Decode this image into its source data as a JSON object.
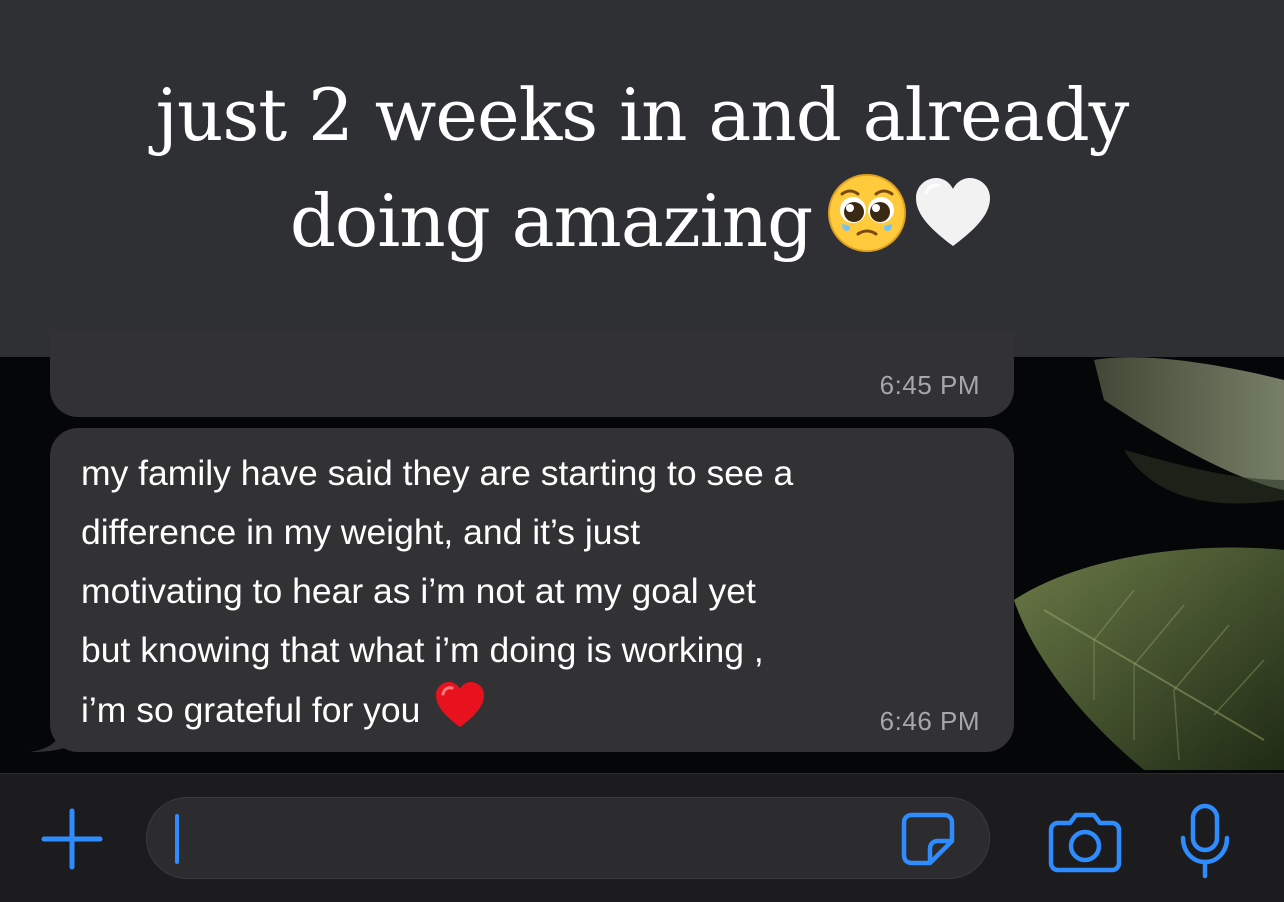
{
  "caption": {
    "line1": "just 2 weeks in and already",
    "line2": "doing amazing",
    "emojis": [
      "pleading-face-emoji",
      "white-heart-emoji"
    ]
  },
  "messages": [
    {
      "id": "previous",
      "time": "6:45 PM"
    },
    {
      "id": "latest",
      "text": "my family have said they are starting to see a\ndifference in my weight, and it’s just\nmotivating to hear as i’m not at my goal yet\nbut knowing that what i’m doing is working ,\ni’m so grateful for you",
      "emoji": "red-heart-emoji",
      "time": "6:46 PM"
    }
  ],
  "input_bar": {
    "value": "",
    "icons": [
      "plus-icon",
      "sticker-icon",
      "camera-icon",
      "microphone-icon"
    ]
  },
  "colors": {
    "accent": "#2f8cff",
    "bubble": "#323234",
    "caption_bg": "#2f3033",
    "timestamp": "#a7a7ab"
  }
}
